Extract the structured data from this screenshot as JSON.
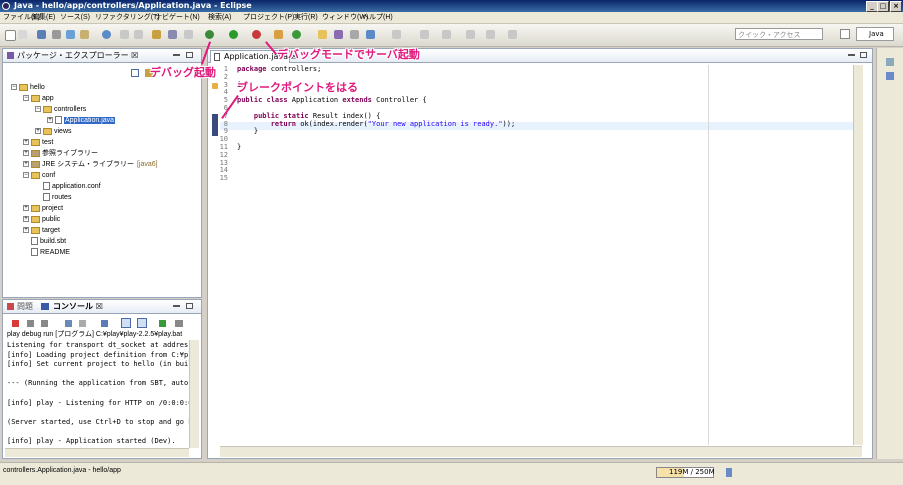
{
  "window": {
    "title": "Java - hello/app/controllers/Application.java - Eclipse",
    "min": "_",
    "max": "□",
    "close": "×"
  },
  "menu": [
    "ファイル(F)",
    "編集(E)",
    "ソース(S)",
    "リファクタリング(T)",
    "ナビゲート(N)",
    "検索(A)",
    "プロジェクト(P)",
    "実行(R)",
    "ウィンドウ(W)",
    "ヘルプ(H)"
  ],
  "toolbar": {
    "quick_access_placeholder": "クイック・アクセス",
    "perspective": "Java"
  },
  "package_explorer": {
    "tab_label": "パッケージ・エクスプローラー ☒",
    "tree": [
      {
        "label": "hello",
        "depth": 0,
        "kind": "project"
      },
      {
        "label": "app",
        "depth": 1,
        "kind": "folder"
      },
      {
        "label": "controllers",
        "depth": 2,
        "kind": "package"
      },
      {
        "label": "Application.java",
        "depth": 3,
        "kind": "java",
        "selected": true
      },
      {
        "label": "views",
        "depth": 2,
        "kind": "package"
      },
      {
        "label": "test",
        "depth": 1,
        "kind": "folder"
      },
      {
        "label": "参照ライブラリー",
        "depth": 1,
        "kind": "lib"
      },
      {
        "label": "JRE システム・ライブラリー",
        "depth": 1,
        "kind": "lib",
        "suffix": "[java6]"
      },
      {
        "label": "conf",
        "depth": 1,
        "kind": "folder"
      },
      {
        "label": "application.conf",
        "depth": 2,
        "kind": "file"
      },
      {
        "label": "routes",
        "depth": 2,
        "kind": "file"
      },
      {
        "label": "project",
        "depth": 1,
        "kind": "folder"
      },
      {
        "label": "public",
        "depth": 1,
        "kind": "folder"
      },
      {
        "label": "target",
        "depth": 1,
        "kind": "folder"
      },
      {
        "label": "build.sbt",
        "depth": 1,
        "kind": "file"
      },
      {
        "label": "README",
        "depth": 1,
        "kind": "file"
      }
    ]
  },
  "editor": {
    "tab_label": "Application.java ☒",
    "line_numbers": [
      "1",
      "2",
      "3",
      "4",
      "5",
      "6",
      "7",
      "8",
      "9",
      "10",
      "11",
      "12",
      "13",
      "14",
      "15"
    ],
    "lines": [
      {
        "parts": [
          [
            "kw",
            "package"
          ],
          [
            "txt",
            " controllers;"
          ]
        ]
      },
      {
        "parts": []
      },
      {
        "parts": [
          [
            "kw",
            "im"
          ]
        ]
      },
      {
        "parts": []
      },
      {
        "parts": [
          [
            "kw",
            "public class"
          ],
          [
            "txt",
            " Application "
          ],
          [
            "kw",
            "extends"
          ],
          [
            "txt",
            " Controller {"
          ]
        ]
      },
      {
        "parts": []
      },
      {
        "parts": [
          [
            "txt",
            "    "
          ],
          [
            "kw",
            "public static"
          ],
          [
            "txt",
            " Result index() {"
          ]
        ]
      },
      {
        "parts": [
          [
            "txt",
            "        "
          ],
          [
            "kw",
            "return"
          ],
          [
            "txt",
            " ok(index.render("
          ],
          [
            "str",
            "\"Your new application is ready.\""
          ],
          [
            "txt",
            "));"
          ]
        ]
      },
      {
        "parts": [
          [
            "txt",
            "    }"
          ]
        ]
      },
      {
        "parts": []
      },
      {
        "parts": [
          [
            "txt",
            "}"
          ]
        ]
      },
      {
        "parts": []
      },
      {
        "parts": []
      },
      {
        "parts": []
      },
      {
        "parts": []
      }
    ]
  },
  "console": {
    "tab_problems": "問題",
    "tab_console": "コンソール ☒",
    "header": "play debug run [プログラム] C:¥play¥play-2.2.5¥play.bat",
    "lines": [
      "Listening for transport dt_socket at address:",
      "[info] Loading project definition from C:¥ple",
      "[info] Set current project to hello (in buil",
      "",
      "--- (Running the application from SBT, auto-r",
      "",
      "[info] play - Listening for HTTP on /0:0:0:0:",
      "",
      "(Server started, use Ctrl+D to stop and go ba",
      "",
      "[info] play - Application started (Dev)."
    ]
  },
  "annotations": {
    "debug_start": "デバッグ起動",
    "debug_server": "デバッグモードでサーバ起動",
    "breakpoint": "ブレークポイントをはる"
  },
  "status": {
    "path": "controllers.Application.java - hello/app",
    "memory": "119M / 250M"
  },
  "colors": {
    "annotation": "#e0197d",
    "selection": "#3169c6",
    "keyword": "#7f0055",
    "string": "#2a00ff"
  }
}
